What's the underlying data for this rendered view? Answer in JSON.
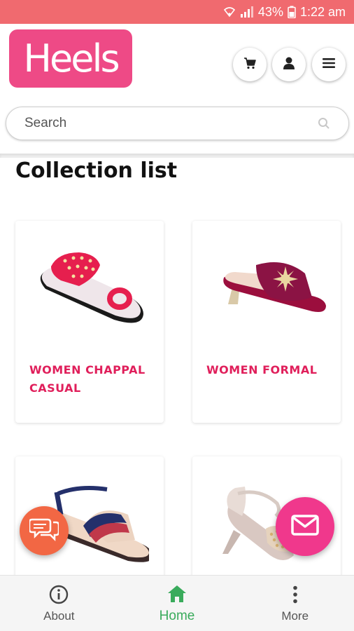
{
  "status_bar": {
    "battery": "43%",
    "time": "1:22 am"
  },
  "header": {
    "logo_text": "Heels",
    "cart_icon": "cart-icon",
    "user_icon": "user-icon",
    "menu_icon": "menu-icon"
  },
  "search": {
    "placeholder": "Search",
    "value": ""
  },
  "section": {
    "title": "Collection list"
  },
  "collections": [
    {
      "title": "WOMEN CHAPPAL CASUAL",
      "image": "pink-chappal"
    },
    {
      "title": "WOMEN FORMAL",
      "image": "maroon-slide"
    },
    {
      "title": "",
      "image": "blue-sandal"
    },
    {
      "title": "",
      "image": "nude-heel"
    }
  ],
  "fabs": {
    "chat_icon": "chat-icon",
    "mail_icon": "mail-icon"
  },
  "bottom_nav": [
    {
      "label": "About",
      "icon": "info-icon"
    },
    {
      "label": "Home",
      "icon": "home-icon",
      "active": true
    },
    {
      "label": "More",
      "icon": "more-vertical-icon"
    }
  ],
  "colors": {
    "status_bar": "#f06a6f",
    "brand": "#ee4a86",
    "accent_title": "#e01f5b",
    "active_nav": "#3aab5c",
    "chat_fab": "#f26744",
    "mail_fab": "#f0388c"
  }
}
